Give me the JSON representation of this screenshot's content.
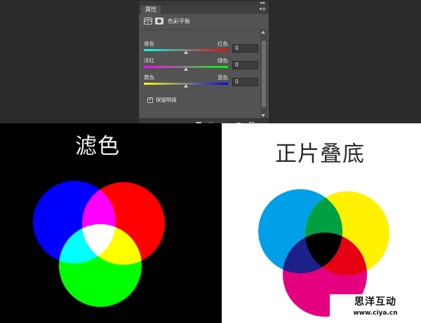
{
  "panel": {
    "tab": "属性",
    "collapse_glyph": "◂◂",
    "menu_glyph": "▾≡",
    "title": "色彩平衡",
    "rows": [
      {
        "left": "青色",
        "right": "红色",
        "value": "0",
        "gradient_from": "#00ffff",
        "gradient_to": "#ff0000",
        "level": 0.5
      },
      {
        "left": "洋红",
        "right": "绿色",
        "value": "0",
        "gradient_from": "#ff00ff",
        "gradient_to": "#00ff00",
        "level": 0.5
      },
      {
        "left": "黄色",
        "right": "蓝色",
        "value": "0",
        "gradient_from": "#ffff00",
        "gradient_to": "#0000ff",
        "level": 0.5
      }
    ],
    "preserve_luminosity": {
      "label": "保留明度",
      "checked": true,
      "check_glyph": "✓"
    },
    "footer_icons": [
      "clip-to-layer-icon",
      "view-previous-icon",
      "reset-icon",
      "visibility-eye-icon",
      "trash-icon"
    ]
  },
  "captions": {
    "screen": "滤色",
    "multiply": "正片叠底"
  },
  "colors": {
    "screen": {
      "blue": "#0000ff",
      "red": "#ff0000",
      "green": "#00ff00",
      "magenta": "#ff00ff",
      "cyan": "#00ffff",
      "yellow": "#ffff00",
      "white": "#ffffff"
    },
    "multiply": {
      "cyan": "#00a0e9",
      "yellow": "#fff100",
      "magenta": "#e4007f",
      "green": "#00a040",
      "blue": "#1d2088",
      "red": "#e60012",
      "black": "#000000"
    }
  },
  "watermark": {
    "title": "思洋互动",
    "url": "www.ciya.cn"
  }
}
